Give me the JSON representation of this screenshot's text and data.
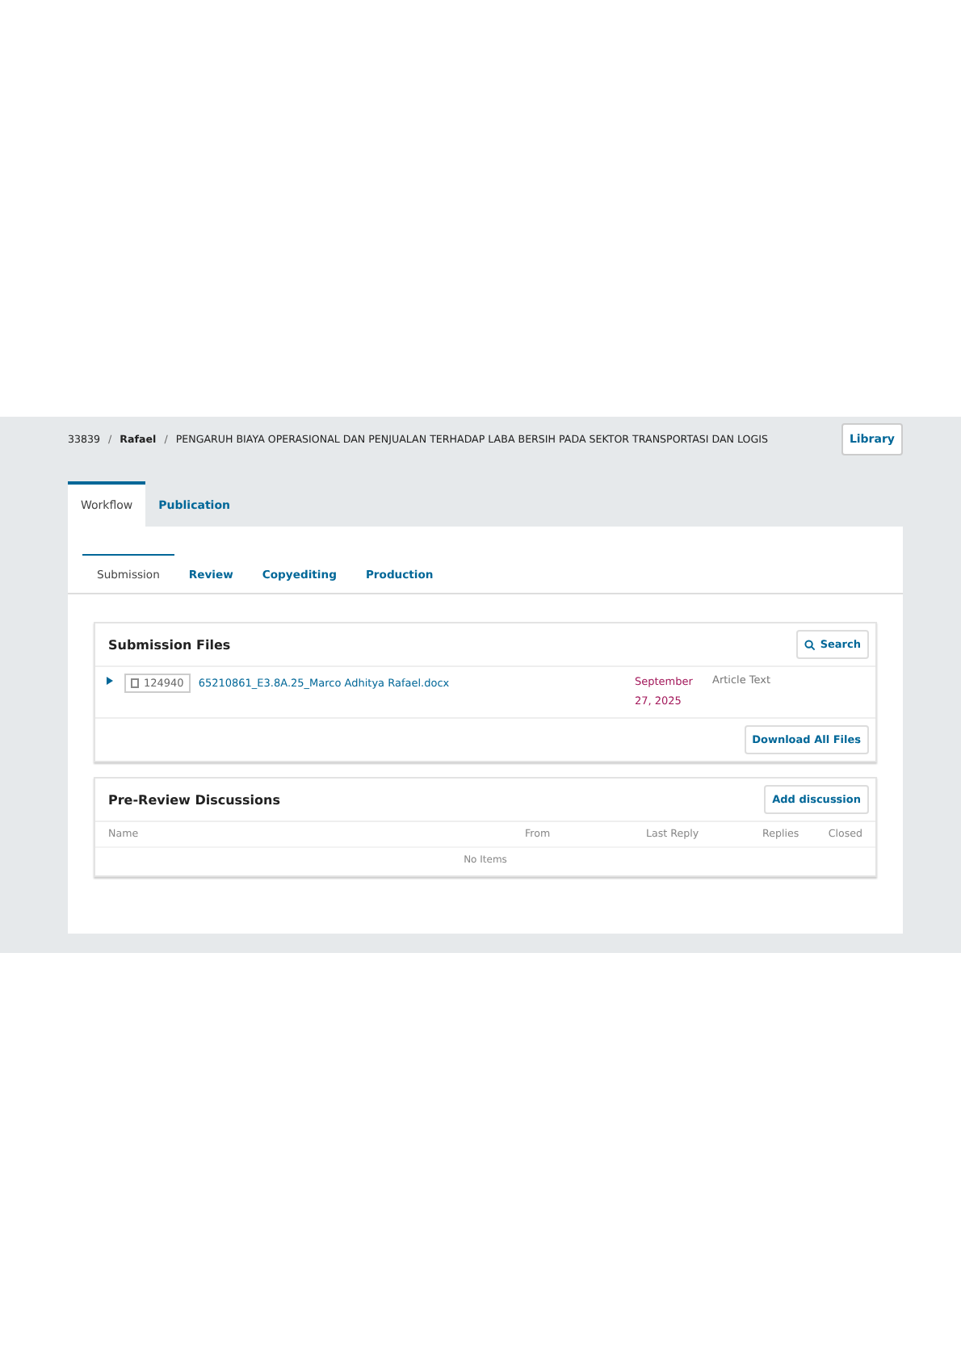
{
  "breadcrumb": {
    "id": "33839",
    "separator": "/",
    "author": "Rafael",
    "title": "PENGARUH BIAYA OPERASIONAL DAN PENJUALAN TERHADAP LABA BERSIH PADA SEKTOR TRANSPORTASI DAN LOGIS"
  },
  "library_button": "Library",
  "tabs": [
    {
      "label": "Workflow",
      "selected": true
    },
    {
      "label": "Publication",
      "selected": false
    }
  ],
  "stage_tabs": [
    {
      "label": "Submission",
      "selected": true
    },
    {
      "label": "Review",
      "selected": false
    },
    {
      "label": "Copyediting",
      "selected": false
    },
    {
      "label": "Production",
      "selected": false
    }
  ],
  "submission_files": {
    "title": "Submission Files",
    "search_button": "Search",
    "files": [
      {
        "file_id": "124940",
        "name": "65210861_E3.8A.25_Marco Adhitya Rafael.docx",
        "date": "September 27, 2025",
        "type": "Article Text"
      }
    ],
    "download_button": "Download All Files"
  },
  "discussions": {
    "title": "Pre-Review Discussions",
    "add_button": "Add discussion",
    "columns": [
      "Name",
      "From",
      "Last Reply",
      "Replies",
      "Closed"
    ],
    "empty": "No Items"
  }
}
